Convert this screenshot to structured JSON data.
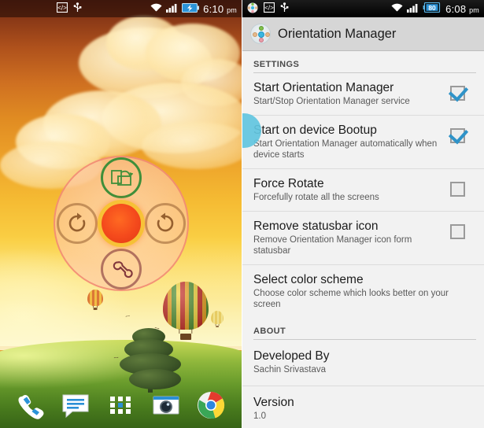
{
  "left_phone": {
    "statusbar": {
      "time": "6:10",
      "ampm": "pm",
      "icons_left": [
        "developer-options-icon",
        "usb-icon"
      ],
      "icons_right": [
        "wifi-icon",
        "cellular-signal-icon",
        "battery-charging-icon"
      ],
      "battery_state": "charging"
    },
    "widget": {
      "name": "Orientation Manager widget",
      "center_label": "",
      "nodes": [
        {
          "position": "top",
          "icon": "auto-rotate-screen-icon",
          "color": "#3f8f3a"
        },
        {
          "position": "left",
          "icon": "rotate-clockwise-icon",
          "color": "#96602f"
        },
        {
          "position": "right",
          "icon": "rotate-counterclockwise-icon",
          "color": "#96602f"
        },
        {
          "position": "bottom",
          "icon": "wrench-settings-icon",
          "color": "#82373c"
        }
      ]
    },
    "dock": [
      {
        "name": "phone",
        "icon": "phone-icon"
      },
      {
        "name": "messaging",
        "icon": "message-icon"
      },
      {
        "name": "app-drawer",
        "icon": "apps-grid-icon"
      },
      {
        "name": "camera",
        "icon": "camera-icon"
      },
      {
        "name": "chrome",
        "icon": "chrome-icon"
      }
    ],
    "wallpaper": {
      "description": "Sunset sky with clouds, green field, tree and hot air balloons",
      "sky_top_color": "#6b2a17",
      "sky_bottom_color": "#f2ef9e",
      "field_color": "#71a52f"
    }
  },
  "right_phone": {
    "statusbar": {
      "time": "6:08",
      "ampm": "pm",
      "icons_left": [
        "orientation-manager-icon",
        "developer-options-icon",
        "usb-icon"
      ],
      "icons_right": [
        "wifi-icon",
        "cellular-signal-icon",
        "battery-icon"
      ],
      "battery_level": "80"
    },
    "actionbar": {
      "title": "Orientation Manager",
      "icon": "orientation-manager-app-icon"
    },
    "sections": [
      {
        "header": "SETTINGS",
        "rows": [
          {
            "title": "Start Orientation Manager",
            "summary": "Start/Stop Orientation Manager service",
            "checked": true
          },
          {
            "title": "Start on device Bootup",
            "summary": "Start Orientation Manager automatically when device starts",
            "checked": true
          },
          {
            "title": "Force Rotate",
            "summary": "Forcefully rotate all the screens",
            "checked": false
          },
          {
            "title": "Remove statusbar icon",
            "summary": "Remove Orientation Manager icon form statusbar",
            "checked": false
          },
          {
            "title": "Select color scheme",
            "summary": "Choose color scheme which looks better on your screen",
            "checked": null
          }
        ]
      },
      {
        "header": "ABOUT",
        "rows": [
          {
            "title": "Developed By",
            "value": "Sachin Srivastava"
          },
          {
            "title": "Version",
            "value": "1.0"
          }
        ]
      }
    ],
    "accent_color": "#2f93c8",
    "ripple_color": "#62c6e0"
  }
}
